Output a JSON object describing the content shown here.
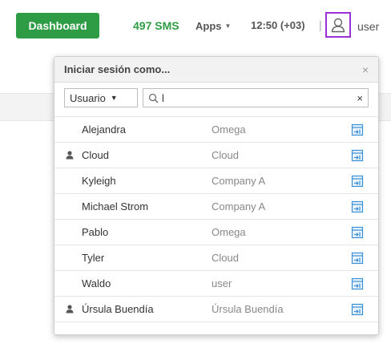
{
  "topbar": {
    "dashboard_label": "Dashboard",
    "sms_count": "497 SMS",
    "apps_label": "Apps",
    "time": "12:50 (+03)",
    "separator": "|",
    "user_label": "user"
  },
  "popup": {
    "title": "Iniciar sesión como...",
    "close": "×",
    "filter_select": "Usuario",
    "search_value": "l",
    "clear": "×"
  },
  "users": [
    {
      "name": "Alejandra",
      "company": "Omega",
      "person_icon": false
    },
    {
      "name": "Cloud",
      "company": "Cloud",
      "person_icon": true
    },
    {
      "name": "Kyleigh",
      "company": "Company A",
      "person_icon": false
    },
    {
      "name": "Michael Strom",
      "company": "Company A",
      "person_icon": false
    },
    {
      "name": "Pablo",
      "company": "Omega",
      "person_icon": false
    },
    {
      "name": "Tyler",
      "company": "Cloud",
      "person_icon": false
    },
    {
      "name": "Waldo",
      "company": "user",
      "person_icon": false
    },
    {
      "name": "Úrsula Buendía",
      "company": "Úrsula Buendía",
      "person_icon": true
    }
  ],
  "colors": {
    "accent_green": "#2e9c44",
    "highlight_purple": "#9b30d9",
    "login_icon_blue": "#3a8fd6"
  }
}
